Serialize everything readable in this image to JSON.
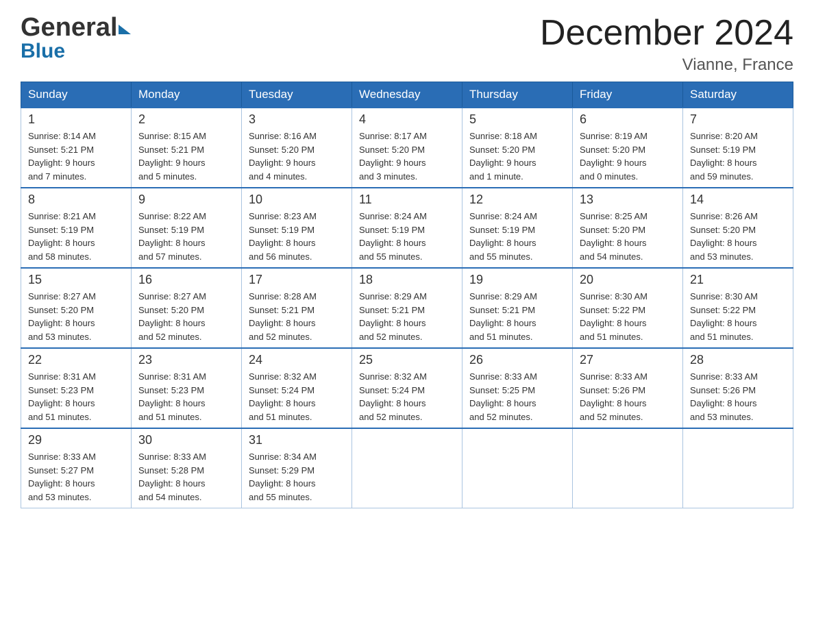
{
  "header": {
    "title": "December 2024",
    "location": "Vianne, France",
    "logo_general": "General",
    "logo_blue": "Blue"
  },
  "weekdays": [
    "Sunday",
    "Monday",
    "Tuesday",
    "Wednesday",
    "Thursday",
    "Friday",
    "Saturday"
  ],
  "weeks": [
    [
      {
        "day": "1",
        "sunrise": "8:14 AM",
        "sunset": "5:21 PM",
        "daylight": "9 hours and 7 minutes."
      },
      {
        "day": "2",
        "sunrise": "8:15 AM",
        "sunset": "5:21 PM",
        "daylight": "9 hours and 5 minutes."
      },
      {
        "day": "3",
        "sunrise": "8:16 AM",
        "sunset": "5:20 PM",
        "daylight": "9 hours and 4 minutes."
      },
      {
        "day": "4",
        "sunrise": "8:17 AM",
        "sunset": "5:20 PM",
        "daylight": "9 hours and 3 minutes."
      },
      {
        "day": "5",
        "sunrise": "8:18 AM",
        "sunset": "5:20 PM",
        "daylight": "9 hours and 1 minute."
      },
      {
        "day": "6",
        "sunrise": "8:19 AM",
        "sunset": "5:20 PM",
        "daylight": "9 hours and 0 minutes."
      },
      {
        "day": "7",
        "sunrise": "8:20 AM",
        "sunset": "5:19 PM",
        "daylight": "8 hours and 59 minutes."
      }
    ],
    [
      {
        "day": "8",
        "sunrise": "8:21 AM",
        "sunset": "5:19 PM",
        "daylight": "8 hours and 58 minutes."
      },
      {
        "day": "9",
        "sunrise": "8:22 AM",
        "sunset": "5:19 PM",
        "daylight": "8 hours and 57 minutes."
      },
      {
        "day": "10",
        "sunrise": "8:23 AM",
        "sunset": "5:19 PM",
        "daylight": "8 hours and 56 minutes."
      },
      {
        "day": "11",
        "sunrise": "8:24 AM",
        "sunset": "5:19 PM",
        "daylight": "8 hours and 55 minutes."
      },
      {
        "day": "12",
        "sunrise": "8:24 AM",
        "sunset": "5:19 PM",
        "daylight": "8 hours and 55 minutes."
      },
      {
        "day": "13",
        "sunrise": "8:25 AM",
        "sunset": "5:20 PM",
        "daylight": "8 hours and 54 minutes."
      },
      {
        "day": "14",
        "sunrise": "8:26 AM",
        "sunset": "5:20 PM",
        "daylight": "8 hours and 53 minutes."
      }
    ],
    [
      {
        "day": "15",
        "sunrise": "8:27 AM",
        "sunset": "5:20 PM",
        "daylight": "8 hours and 53 minutes."
      },
      {
        "day": "16",
        "sunrise": "8:27 AM",
        "sunset": "5:20 PM",
        "daylight": "8 hours and 52 minutes."
      },
      {
        "day": "17",
        "sunrise": "8:28 AM",
        "sunset": "5:21 PM",
        "daylight": "8 hours and 52 minutes."
      },
      {
        "day": "18",
        "sunrise": "8:29 AM",
        "sunset": "5:21 PM",
        "daylight": "8 hours and 52 minutes."
      },
      {
        "day": "19",
        "sunrise": "8:29 AM",
        "sunset": "5:21 PM",
        "daylight": "8 hours and 51 minutes."
      },
      {
        "day": "20",
        "sunrise": "8:30 AM",
        "sunset": "5:22 PM",
        "daylight": "8 hours and 51 minutes."
      },
      {
        "day": "21",
        "sunrise": "8:30 AM",
        "sunset": "5:22 PM",
        "daylight": "8 hours and 51 minutes."
      }
    ],
    [
      {
        "day": "22",
        "sunrise": "8:31 AM",
        "sunset": "5:23 PM",
        "daylight": "8 hours and 51 minutes."
      },
      {
        "day": "23",
        "sunrise": "8:31 AM",
        "sunset": "5:23 PM",
        "daylight": "8 hours and 51 minutes."
      },
      {
        "day": "24",
        "sunrise": "8:32 AM",
        "sunset": "5:24 PM",
        "daylight": "8 hours and 51 minutes."
      },
      {
        "day": "25",
        "sunrise": "8:32 AM",
        "sunset": "5:24 PM",
        "daylight": "8 hours and 52 minutes."
      },
      {
        "day": "26",
        "sunrise": "8:33 AM",
        "sunset": "5:25 PM",
        "daylight": "8 hours and 52 minutes."
      },
      {
        "day": "27",
        "sunrise": "8:33 AM",
        "sunset": "5:26 PM",
        "daylight": "8 hours and 52 minutes."
      },
      {
        "day": "28",
        "sunrise": "8:33 AM",
        "sunset": "5:26 PM",
        "daylight": "8 hours and 53 minutes."
      }
    ],
    [
      {
        "day": "29",
        "sunrise": "8:33 AM",
        "sunset": "5:27 PM",
        "daylight": "8 hours and 53 minutes."
      },
      {
        "day": "30",
        "sunrise": "8:33 AM",
        "sunset": "5:28 PM",
        "daylight": "8 hours and 54 minutes."
      },
      {
        "day": "31",
        "sunrise": "8:34 AM",
        "sunset": "5:29 PM",
        "daylight": "8 hours and 55 minutes."
      },
      null,
      null,
      null,
      null
    ]
  ]
}
